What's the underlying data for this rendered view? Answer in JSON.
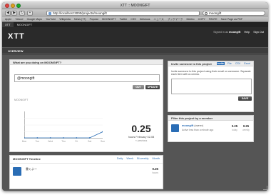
{
  "window": {
    "title": "XTT :: MOONGIFT"
  },
  "toolbar": {
    "url": "http://localhost:3000/projects/moongift",
    "search_value": "moongift",
    "back": "◀",
    "forward": "▶",
    "reload": "↻",
    "add": "+"
  },
  "bookmarks": [
    "Apple",
    "Yahoo!",
    "Google Maps",
    "YouTube",
    "Wikipedia",
    "News (77)",
    "Popular",
    "MOONGIFT",
    "Twitter",
    "CSS",
    "Delicious",
    "ニュース",
    "ブックマーク",
    "Meebo",
    "COPY",
    "PASTE",
    "Save Page as PDF"
  ],
  "tabs": [
    "XTT",
    "MOONGIFT"
  ],
  "app": {
    "logo": "XTT",
    "signed_in_prefix": "Signed in as",
    "user": "moongift",
    "help": "Help",
    "sign_out": "Sign Out",
    "subnav": "OVERVIEW"
  },
  "status_panel": {
    "title": "What are you doing on MOONGIFT?",
    "input_value": "@moongift",
    "out_label": "OUT",
    "update_label": "UPDATE",
    "section_label": "MOONGIFT",
    "hours": "0.25",
    "hours_date": "hours February 02-08",
    "previous": "« previous"
  },
  "chart_data": {
    "type": "line",
    "categories": [
      "Mon",
      "Tue",
      "Wed",
      "Thu",
      "Fri",
      "Sat",
      "Sun"
    ],
    "values": [
      0,
      0,
      0,
      0,
      0,
      0,
      0.25
    ]
  },
  "timeline": {
    "title": "MOONGIFT Timeline",
    "filters": [
      "Daily",
      "Week",
      "Bi-weekly",
      "Month"
    ],
    "entry_text": "書くよー",
    "entry_value": "0.25",
    "entry_unit": "hours"
  },
  "invite": {
    "title": "Invite someone to this project",
    "tabs": [
      "Invite",
      "File",
      "CSV",
      "Excel"
    ],
    "text": "Invite someone to this project using their email or username. Separate each item with a comma.",
    "save_label": "SAVE"
  },
  "filter": {
    "title": "Filter this project by a member",
    "name": "moongift",
    "role": "(owner)",
    "active": "Active less than a minute ago",
    "today_value": "0.25",
    "today_label": "today",
    "weekly_value": "0.25",
    "weekly_label": "weekly"
  },
  "colors": {
    "accent": "#2a6db5",
    "header": "#2a2a2a",
    "content_bg": "#555555"
  }
}
